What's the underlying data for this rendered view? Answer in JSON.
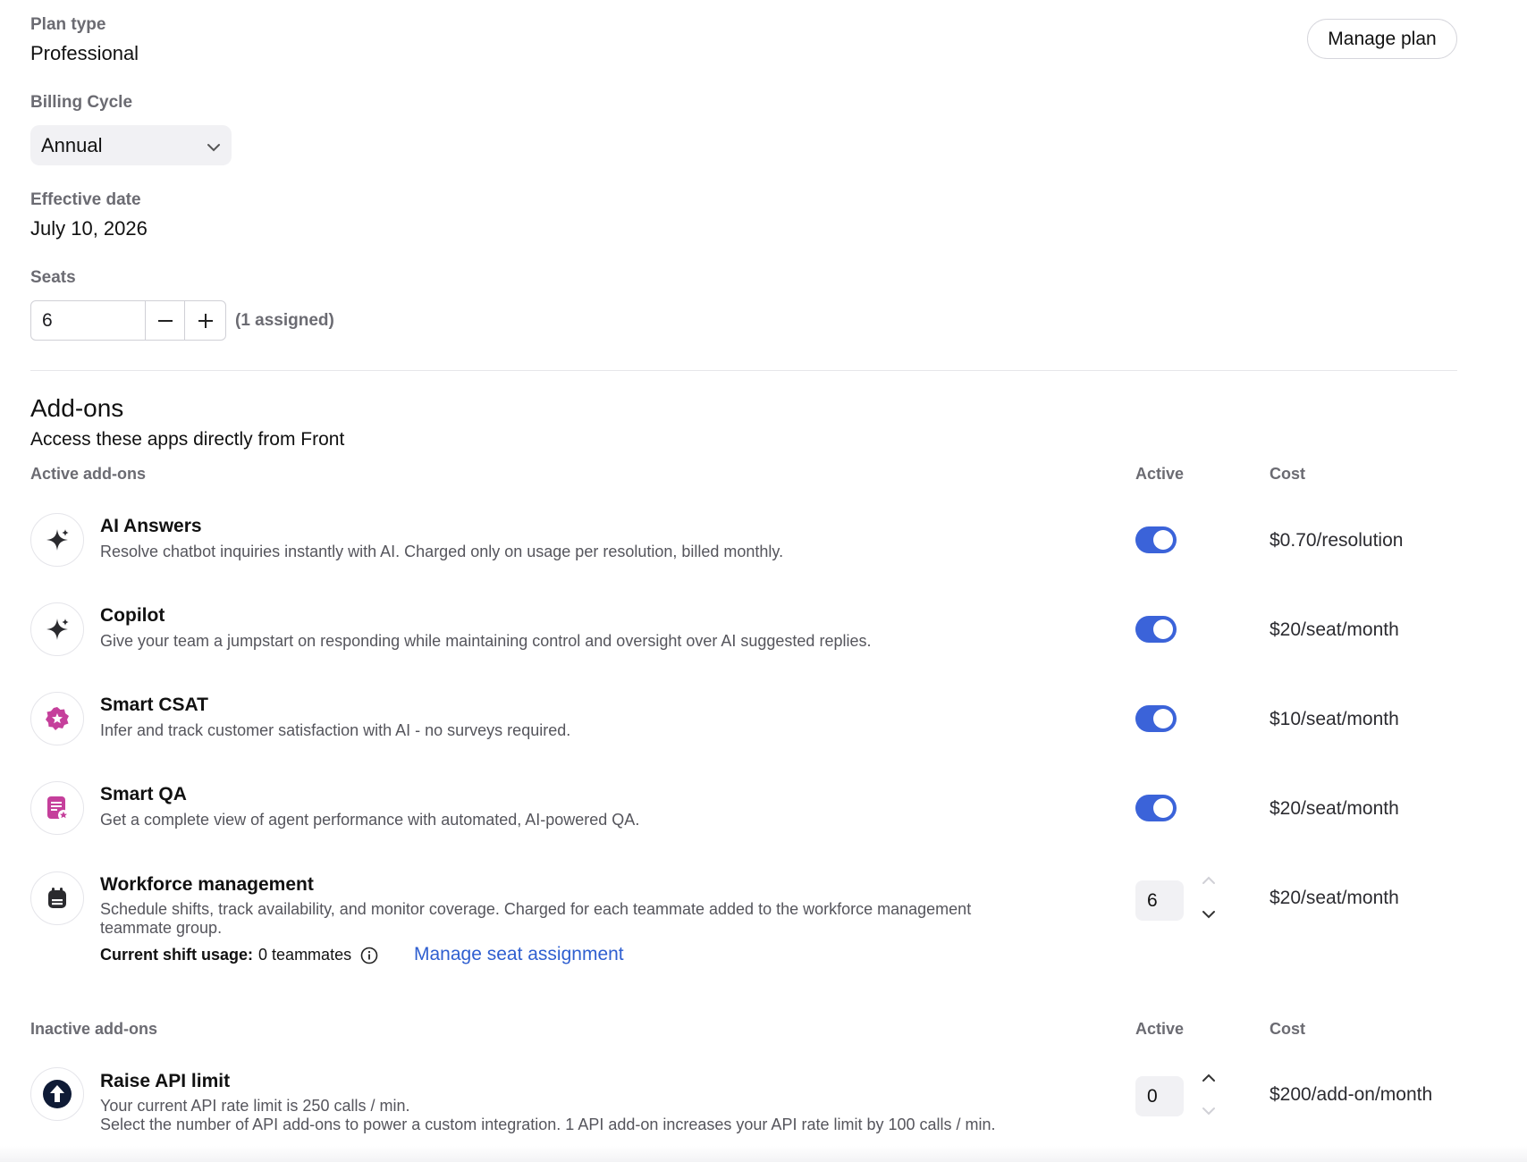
{
  "plan": {
    "plan_type_label": "Plan type",
    "plan_type_value": "Professional",
    "manage_plan_label": "Manage plan",
    "billing_cycle_label": "Billing Cycle",
    "billing_cycle_value": "Annual",
    "effective_date_label": "Effective date",
    "effective_date_value": "July 10, 2026",
    "seats_label": "Seats",
    "seats_value": "6",
    "seats_assigned": "(1 assigned)"
  },
  "addons": {
    "title": "Add-ons",
    "subtitle": "Access these apps directly from Front",
    "active_section": {
      "heading": "Active add-ons",
      "col_active": "Active",
      "col_cost": "Cost",
      "items": [
        {
          "name": "AI Answers",
          "desc": "Resolve chatbot inquiries instantly with AI. Charged only on usage per resolution, billed monthly.",
          "cost": "$0.70/resolution",
          "active": true,
          "icon": "sparkle-icon"
        },
        {
          "name": "Copilot",
          "desc": "Give your team a jumpstart on responding while maintaining control and oversight over AI suggested replies.",
          "cost": "$20/seat/month",
          "active": true,
          "icon": "sparkle-icon"
        },
        {
          "name": "Smart CSAT",
          "desc": "Infer and track customer satisfaction with AI - no surveys required.",
          "cost": "$10/seat/month",
          "active": true,
          "icon": "star-badge-icon"
        },
        {
          "name": "Smart QA",
          "desc": "Get a complete view of agent performance with automated, AI-powered QA.",
          "cost": "$20/seat/month",
          "active": true,
          "icon": "document-star-icon"
        }
      ],
      "workforce": {
        "name": "Workforce management",
        "desc_line1": "Schedule shifts, track availability, and monitor coverage. Charged for each teammate added to the workforce management",
        "desc_line2": "teammate group.",
        "usage_label": "Current shift usage:",
        "usage_value": "0 teammates",
        "link": "Manage seat assignment",
        "quantity": "6",
        "cost": "$20/seat/month",
        "icon": "calendar-icon"
      }
    },
    "inactive_section": {
      "heading": "Inactive add-ons",
      "col_active": "Active",
      "col_cost": "Cost",
      "api": {
        "name": "Raise API limit",
        "desc_line1": "Your current API rate limit is 250 calls / min.",
        "desc_line2": "Select the number of API add-ons to power a custom integration. 1 API add-on increases your API rate limit by 100 calls / min.",
        "quantity": "0",
        "cost": "$200/add-on/month",
        "icon": "arrow-up-circle-icon"
      }
    }
  },
  "colors": {
    "toggle_on": "#3b63d9",
    "link": "#2f5fd0",
    "csat_icon": "#c53f9b",
    "qa_icon": "#c53f9b"
  }
}
